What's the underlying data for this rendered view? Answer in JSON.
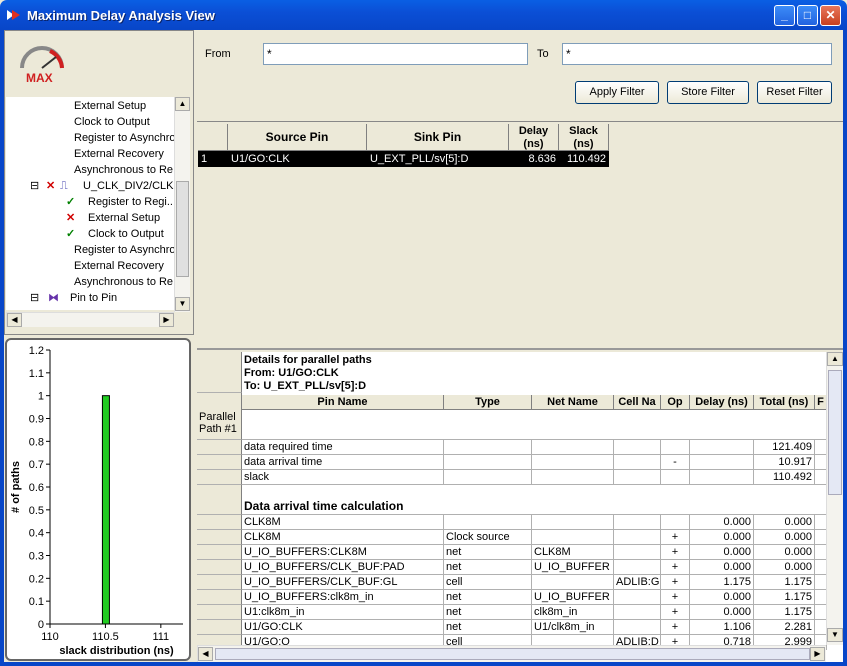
{
  "window": {
    "title": "Maximum Delay Analysis View"
  },
  "logo": {
    "label": "MAX"
  },
  "tree": {
    "items": [
      "External Setup",
      "Clock to Output",
      "Register to Asynchro",
      "External Recovery",
      "Asynchronous to Re",
      "U_CLK_DIV2/CLK",
      "Register to Regi...",
      "External Setup",
      "Clock to Output",
      "Register to Asynchro",
      "External Recovery",
      "Asynchronous to Re",
      "Pin to Pin"
    ]
  },
  "filter": {
    "from_label": "From",
    "from_value": "*",
    "to_label": "To",
    "to_value": "*",
    "apply": "Apply Filter",
    "store": "Store Filter",
    "reset": "Reset Filter"
  },
  "paths": {
    "headers": [
      "Source Pin",
      "Sink Pin",
      "Delay (ns)",
      "Slack (ns)"
    ],
    "rows": [
      {
        "index": "1",
        "source": "U1/GO:CLK",
        "sink": "U_EXT_PLL/sv[5]:D",
        "delay": "8.636",
        "slack": "110.492"
      }
    ]
  },
  "details": {
    "title1": "Details for parallel paths",
    "title2": "From: U1/GO:CLK",
    "title3": "To: U_EXT_PLL/sv[5]:D",
    "parallel_label": "Parallel Path #1",
    "section": "Data arrival time calculation",
    "headers": [
      "Pin Name",
      "Type",
      "Net Name",
      "Cell Na",
      "Op",
      "Delay (ns)",
      "Total (ns)",
      "F"
    ],
    "summary": [
      {
        "pin": "data required time",
        "op": "",
        "total": "121.409"
      },
      {
        "pin": "data arrival time",
        "op": "-",
        "total": "10.917"
      },
      {
        "pin": "slack",
        "op": "",
        "total": "110.492"
      }
    ],
    "rows": [
      {
        "pin": "CLK8M",
        "type": "",
        "net": "",
        "cell": "",
        "op": "",
        "delay": "0.000",
        "total": "0.000"
      },
      {
        "pin": "CLK8M",
        "type": "Clock source",
        "net": "",
        "cell": "",
        "op": "+",
        "delay": "0.000",
        "total": "0.000"
      },
      {
        "pin": "U_IO_BUFFERS:CLK8M",
        "type": "net",
        "net": "CLK8M",
        "cell": "",
        "op": "+",
        "delay": "0.000",
        "total": "0.000"
      },
      {
        "pin": "U_IO_BUFFERS/CLK_BUF:PAD",
        "type": "net",
        "net": "U_IO_BUFFER",
        "cell": "",
        "op": "+",
        "delay": "0.000",
        "total": "0.000"
      },
      {
        "pin": "U_IO_BUFFERS/CLK_BUF:GL",
        "type": "cell",
        "net": "",
        "cell": "ADLIB:G",
        "op": "+",
        "delay": "1.175",
        "total": "1.175"
      },
      {
        "pin": "U_IO_BUFFERS:clk8m_in",
        "type": "net",
        "net": "U_IO_BUFFER",
        "cell": "",
        "op": "+",
        "delay": "0.000",
        "total": "1.175"
      },
      {
        "pin": "U1:clk8m_in",
        "type": "net",
        "net": "clk8m_in",
        "cell": "",
        "op": "+",
        "delay": "0.000",
        "total": "1.175"
      },
      {
        "pin": "U1/GO:CLK",
        "type": "net",
        "net": "U1/clk8m_in",
        "cell": "",
        "op": "+",
        "delay": "1.106",
        "total": "2.281"
      },
      {
        "pin": "U1/GO:Q",
        "type": "cell",
        "net": "",
        "cell": "ADLIB:D",
        "op": "+",
        "delay": "0.718",
        "total": "2.999"
      }
    ]
  },
  "chart_data": {
    "type": "bar",
    "categories": [
      "110.5"
    ],
    "values": [
      1
    ],
    "xlabel": "slack distribution (ns)",
    "ylabel": "# of paths",
    "ylim": [
      0,
      1.2
    ],
    "yticks": [
      "0",
      "0.1",
      "0.2",
      "0.3",
      "0.4",
      "0.5",
      "0.6",
      "0.7",
      "0.8",
      "0.9",
      "1",
      "1.1",
      "1.2"
    ],
    "xticks": [
      "110",
      "110.5",
      "111",
      "111."
    ],
    "xlim": [
      110,
      111.2
    ],
    "bar_color": "#22cc22"
  }
}
